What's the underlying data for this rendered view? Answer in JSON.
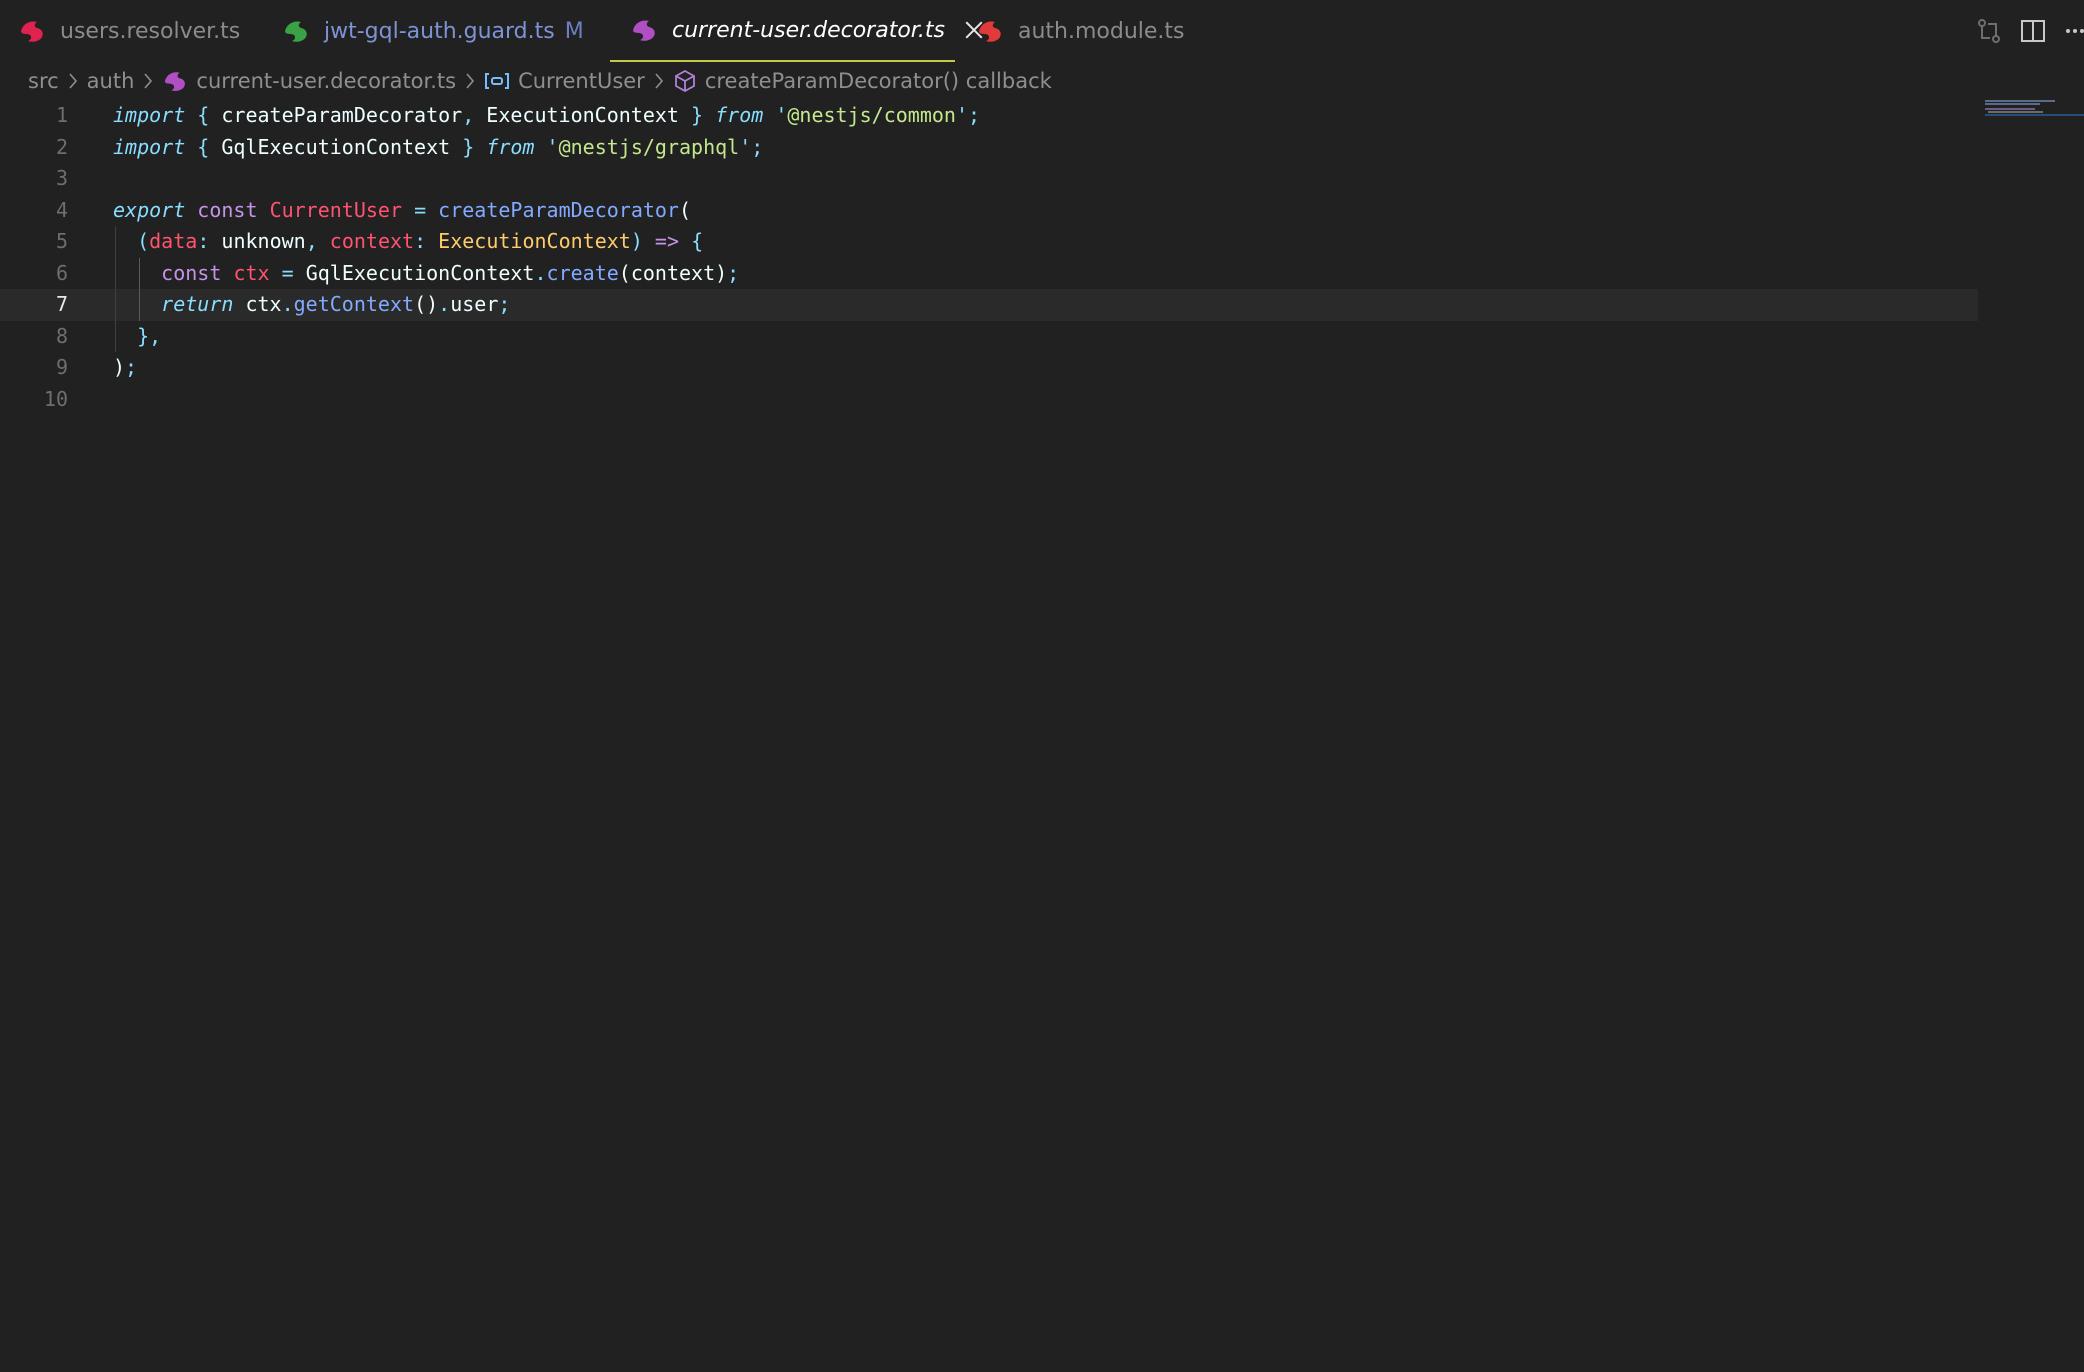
{
  "tabs": [
    {
      "label": "users.resolver.ts",
      "icon": "nestjs-icon",
      "color": "#e0234e"
    },
    {
      "label": "jwt-gql-auth.guard.ts",
      "modified": "M",
      "icon": "nestjs-icon",
      "color": "#3aa245"
    },
    {
      "label": "current-user.decorator.ts",
      "icon": "nestjs-icon",
      "color": "#b04fc4",
      "active": true
    },
    {
      "label": "auth.module.ts",
      "icon": "nestjs-icon",
      "color": "#e03a3a"
    }
  ],
  "tab_actions": [
    "open-changes-icon",
    "split-editor-icon",
    "more-actions-icon"
  ],
  "breadcrumb": {
    "src": "src",
    "auth": "auth",
    "file": "current-user.decorator.ts",
    "symbol": "CurrentUser",
    "callback": "createParamDecorator() callback"
  },
  "editor": {
    "current_line": 7,
    "line_numbers": [
      "1",
      "2",
      "3",
      "4",
      "5",
      "6",
      "7",
      "8",
      "9",
      "10"
    ],
    "lines": [
      [
        [
          "import",
          "kw-it"
        ],
        [
          " ",
          "plain"
        ],
        [
          "{",
          "punct"
        ],
        [
          " createParamDecorator",
          "ident"
        ],
        [
          ",",
          "punct"
        ],
        [
          " ExecutionContext ",
          "ident"
        ],
        [
          "}",
          "punct"
        ],
        [
          " ",
          "plain"
        ],
        [
          "from",
          "kw-it"
        ],
        [
          " ",
          "plain"
        ],
        [
          "'",
          "punct"
        ],
        [
          "@nestjs/common",
          "str"
        ],
        [
          "'",
          "punct"
        ],
        [
          ";",
          "punct"
        ]
      ],
      [
        [
          "import",
          "kw-it"
        ],
        [
          " ",
          "plain"
        ],
        [
          "{",
          "punct"
        ],
        [
          " GqlExecutionContext ",
          "ident"
        ],
        [
          "}",
          "punct"
        ],
        [
          " ",
          "plain"
        ],
        [
          "from",
          "kw-it"
        ],
        [
          " ",
          "plain"
        ],
        [
          "'",
          "punct"
        ],
        [
          "@nestjs/graphql",
          "str"
        ],
        [
          "'",
          "punct"
        ],
        [
          ";",
          "punct"
        ]
      ],
      [],
      [
        [
          "export",
          "kw-it"
        ],
        [
          " ",
          "plain"
        ],
        [
          "const",
          "kw"
        ],
        [
          " ",
          "plain"
        ],
        [
          "CurrentUser",
          "const-name"
        ],
        [
          " ",
          "plain"
        ],
        [
          "=",
          "punct"
        ],
        [
          " ",
          "plain"
        ],
        [
          "createParamDecorator",
          "fn"
        ],
        [
          "(",
          "plain"
        ]
      ],
      [
        [
          "  ",
          "plain"
        ],
        [
          "(",
          "punct"
        ],
        [
          "data",
          "param"
        ],
        [
          ":",
          "punct"
        ],
        [
          " unknown",
          "ident"
        ],
        [
          ",",
          "punct"
        ],
        [
          " ",
          "plain"
        ],
        [
          "context",
          "param"
        ],
        [
          ":",
          "punct"
        ],
        [
          " ",
          "plain"
        ],
        [
          "ExecutionContext",
          "type"
        ],
        [
          ")",
          "punct"
        ],
        [
          " ",
          "plain"
        ],
        [
          "=>",
          "kw"
        ],
        [
          " ",
          "plain"
        ],
        [
          "{",
          "punct"
        ]
      ],
      [
        [
          "    ",
          "plain"
        ],
        [
          "const",
          "kw"
        ],
        [
          " ",
          "plain"
        ],
        [
          "ctx",
          "const-name"
        ],
        [
          " ",
          "plain"
        ],
        [
          "=",
          "punct"
        ],
        [
          " GqlExecutionContext",
          "ident"
        ],
        [
          ".",
          "punct"
        ],
        [
          "create",
          "fn"
        ],
        [
          "(context)",
          "plain"
        ],
        [
          ";",
          "punct"
        ]
      ],
      [
        [
          "    ",
          "plain"
        ],
        [
          "return",
          "kw-it"
        ],
        [
          " ctx",
          "ident"
        ],
        [
          ".",
          "punct"
        ],
        [
          "getContext",
          "fn"
        ],
        [
          "()",
          "plain"
        ],
        [
          ".",
          "punct"
        ],
        [
          "user",
          "ident"
        ],
        [
          ";",
          "punct"
        ]
      ],
      [
        [
          "  ",
          "plain"
        ],
        [
          "}",
          "punct"
        ],
        [
          ",",
          "punct"
        ]
      ],
      [
        [
          "",
          "plain"
        ],
        [
          ")",
          "plain"
        ],
        [
          ";",
          "punct"
        ]
      ],
      []
    ]
  },
  "colors": {
    "background": "#212121",
    "active_tab_underline": "#c5c94a",
    "current_line": "#2a2a2a"
  }
}
